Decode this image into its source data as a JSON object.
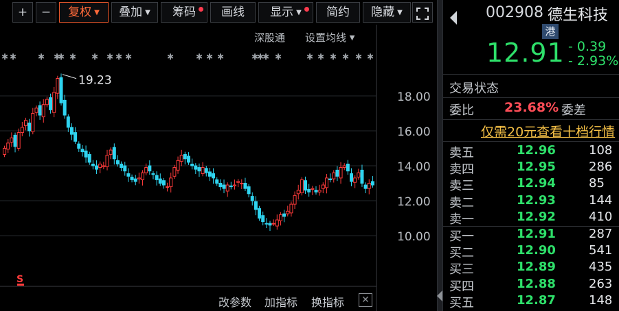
{
  "toolbar": {
    "plus": "+",
    "minus": "−",
    "fuquan": "复权",
    "diejia": "叠加",
    "chouma": "筹码",
    "huaxian": "画线",
    "xianshi": "显示",
    "jianyue": "简约",
    "yincang": "隐藏"
  },
  "chart_links": {
    "shengutong": "深股通",
    "ma_settings": "设置均线"
  },
  "chart_bottom": {
    "params": "改参数",
    "add_indicator": "加指标",
    "switch_indicator": "换指标",
    "close": "✕"
  },
  "chart_data": {
    "type": "candlestick",
    "y_ticks": [
      "18.00",
      "16.00",
      "14.00",
      "12.00",
      "10.00"
    ],
    "y_tick_values": [
      18,
      16,
      14,
      12,
      10
    ],
    "high_annotation": "19.23",
    "high_value": 19.23,
    "up_color": "#ff3b3b",
    "down_color": "#2fd4f0",
    "closes": [
      15.0,
      15.3,
      15.6,
      15.1,
      15.9,
      16.2,
      16.6,
      16.0,
      17.0,
      17.3,
      16.9,
      17.5,
      17.8,
      17.2,
      18.2,
      19.0,
      17.6,
      16.9,
      16.2,
      15.8,
      15.4,
      15.0,
      14.8,
      14.5,
      14.2,
      14.0,
      13.8,
      14.1,
      14.0,
      14.6,
      14.9,
      14.4,
      14.1,
      13.9,
      13.7,
      13.4,
      13.2,
      13.1,
      13.3,
      13.6,
      13.9,
      13.7,
      13.5,
      13.2,
      13.0,
      12.9,
      12.8,
      13.3,
      13.9,
      14.3,
      14.6,
      14.4,
      14.2,
      14.0,
      13.8,
      13.7,
      13.9,
      13.6,
      13.4,
      13.3,
      13.0,
      12.8,
      12.7,
      12.9,
      12.8,
      12.9,
      13.1,
      13.0,
      12.7,
      12.4,
      12.0,
      11.5,
      11.0,
      10.8,
      10.7,
      10.6,
      10.7,
      10.9,
      11.2,
      11.1,
      11.4,
      11.8,
      12.3,
      12.6,
      13.2,
      12.6,
      12.5,
      12.7,
      12.5,
      12.6,
      12.9,
      13.3,
      13.2,
      13.6,
      13.4,
      13.9,
      14.0,
      13.7,
      13.1,
      13.3,
      13.6,
      13.0,
      12.7,
      13.0,
      12.9
    ]
  },
  "quote": {
    "code": "002908",
    "name": "德生科技",
    "badge": "港",
    "price": "12.91",
    "change": "- 0.39",
    "change_pct": "- 2.93%",
    "status_label": "交易状态",
    "webi_label": "委比",
    "webi_value": "23.68%",
    "weicha_label": "委差",
    "promo": "仅需20元查看十档行情"
  },
  "orderbook": {
    "asks": [
      {
        "label": "卖五",
        "price": "12.96",
        "vol": "108"
      },
      {
        "label": "卖四",
        "price": "12.95",
        "vol": "286"
      },
      {
        "label": "卖三",
        "price": "12.94",
        "vol": "85"
      },
      {
        "label": "卖二",
        "price": "12.93",
        "vol": "144"
      },
      {
        "label": "卖一",
        "price": "12.92",
        "vol": "410"
      }
    ],
    "bids": [
      {
        "label": "买一",
        "price": "12.91",
        "vol": "287"
      },
      {
        "label": "买二",
        "price": "12.90",
        "vol": "541"
      },
      {
        "label": "买三",
        "price": "12.89",
        "vol": "435"
      },
      {
        "label": "买四",
        "price": "12.88",
        "vol": "263"
      },
      {
        "label": "买五",
        "price": "12.87",
        "vol": "148"
      }
    ]
  }
}
